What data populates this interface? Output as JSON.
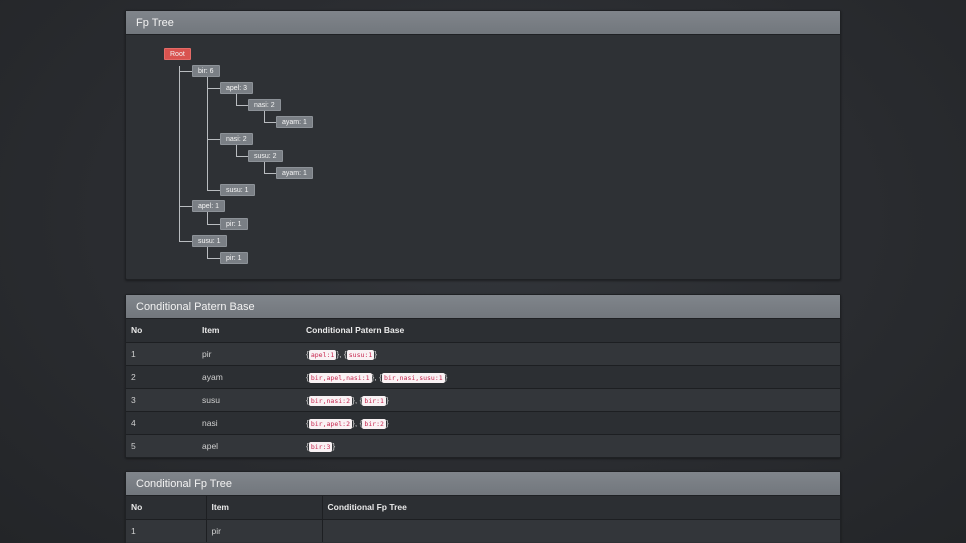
{
  "fp_tree": {
    "title": "Fp Tree",
    "nodes": {
      "root": "Root",
      "bir": "bir: 6",
      "bir_apel": "apel: 3",
      "bir_apel_nasi": "nasi: 2",
      "bir_apel_nasi_ayam": "ayam: 1",
      "bir_nasi": "nasi: 2",
      "bir_nasi_susu": "susu: 2",
      "bir_nasi_susu_ayam": "ayam: 1",
      "bir_susu": "susu: 1",
      "apel": "apel: 1",
      "apel_pir": "pir: 1",
      "susu": "susu: 1",
      "susu_pir": "pir: 1"
    }
  },
  "conditional_pattern_base": {
    "title": "Conditional Patern Base",
    "headers": [
      "No",
      "Item",
      "Conditional Patern Base"
    ],
    "rows": [
      {
        "no": "1",
        "item": "pir",
        "codes": [
          "apel:1",
          "susu:1"
        ]
      },
      {
        "no": "2",
        "item": "ayam",
        "codes": [
          "bir,apel,nasi:1",
          "bir,nasi,susu:1"
        ]
      },
      {
        "no": "3",
        "item": "susu",
        "codes": [
          "bir,nasi:2",
          "bir:1"
        ]
      },
      {
        "no": "4",
        "item": "nasi",
        "codes": [
          "bir,apel:2",
          "bir:2"
        ]
      },
      {
        "no": "5",
        "item": "apel",
        "codes": [
          "bir:3"
        ]
      }
    ]
  },
  "conditional_fp_tree": {
    "title": "Conditional Fp Tree",
    "headers": [
      "No",
      "Item",
      "Conditional Fp Tree"
    ],
    "rows": [
      {
        "no": "1",
        "item": "pir",
        "value": ""
      }
    ]
  }
}
